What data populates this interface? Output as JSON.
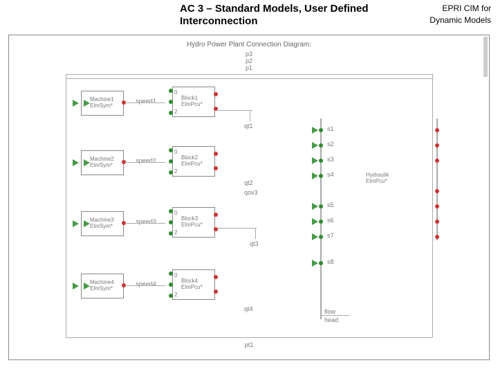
{
  "header": {
    "title_main": "AC 3 – Standard Models, User Defined",
    "title_sub": "Interconnection",
    "epri1": "EPRI CIM for",
    "epri2": "Dynamic Models"
  },
  "diagram": {
    "title": "Hydro Power Plant Connection Diagram:",
    "p_labels": {
      "p1": "p1",
      "p2": "p2",
      "p3": "p3"
    },
    "machines": [
      {
        "label": "Machine1",
        "sub": "ElmSym*",
        "speed": "speed1"
      },
      {
        "label": "Machine2",
        "sub": "ElmSym*",
        "speed": "speed2"
      },
      {
        "label": "Machine3",
        "sub": "ElmSym*",
        "speed": "speed3"
      },
      {
        "label": "Machine4",
        "sub": "ElmSym*",
        "speed": "speed4"
      }
    ],
    "blocks": [
      {
        "label": "Block1",
        "sub": "ElmPcu*"
      },
      {
        "label": "Block2",
        "sub": "ElmPcu*"
      },
      {
        "label": "Block3",
        "sub": "ElmPcu*"
      },
      {
        "label": "Block4",
        "sub": "ElmPcu*"
      }
    ],
    "q_labels": {
      "qt1": "qt1",
      "qt2": "qt2",
      "qt3": "qt3",
      "qt4": "qt4",
      "qov3": "qov3"
    },
    "s_labels": [
      "s1",
      "s2",
      "s3",
      "s4",
      "s5",
      "s6",
      "s7",
      "s8"
    ],
    "hydraulic": {
      "label": "Hydraulik",
      "sub": "ElmPcu*"
    },
    "out": {
      "flow": "flow",
      "head": "head",
      "pt1": "pt1"
    }
  }
}
